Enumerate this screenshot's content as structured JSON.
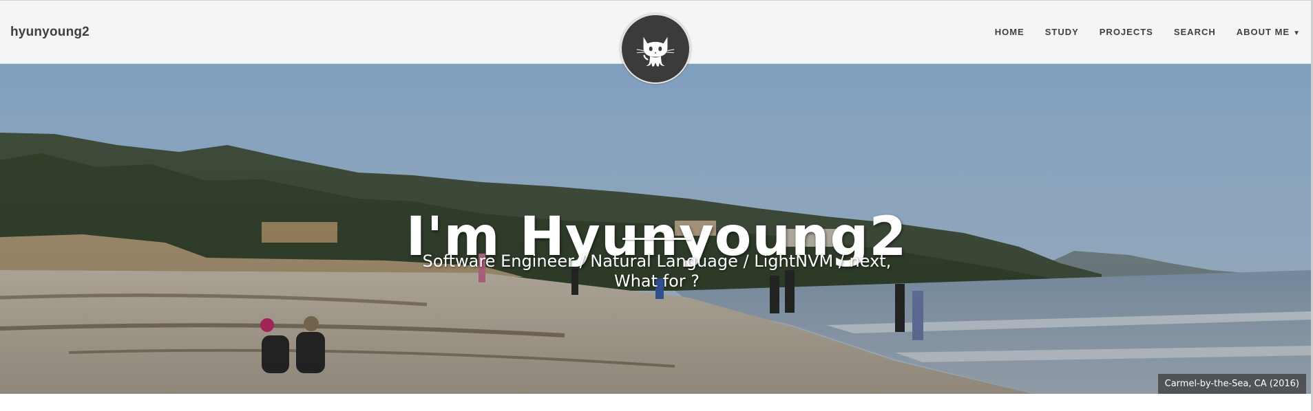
{
  "navbar": {
    "brand": "hyunyoung2",
    "links": [
      {
        "label": "HOME"
      },
      {
        "label": "STUDY"
      },
      {
        "label": "PROJECTS"
      },
      {
        "label": "SEARCH"
      },
      {
        "label": "ABOUT ME",
        "caret": "▼"
      }
    ],
    "avatar_icon": "github-octocat-icon"
  },
  "hero": {
    "heading": "I'm Hyunyoung2",
    "subheading_line1": "Software Engineer / Natural Language / LightNVM / next,",
    "subheading_line2": "What for ?",
    "caption": "Carmel-by-the-Sea, CA (2016)",
    "background": "beach-photo"
  },
  "colors": {
    "navbar_bg": "#f5f5f5",
    "text_dark": "#404040",
    "avatar_bg": "#3b3b3b",
    "hero_text": "#ffffff"
  }
}
